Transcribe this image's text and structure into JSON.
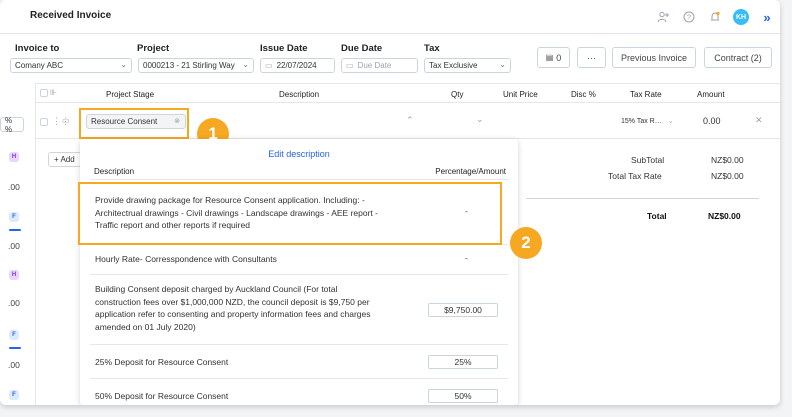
{
  "header": {
    "title": "Received Invoice",
    "icons": [
      "add-user-icon",
      "help-icon",
      "bell-icon"
    ],
    "avatar": "KH"
  },
  "filters": {
    "invoice_to": {
      "label": "Invoice to",
      "value": "Comany ABC"
    },
    "project": {
      "label": "Project",
      "value": "0000213 - 21 Stirling Way"
    },
    "issue_date": {
      "label": "Issue Date",
      "value": "22/07/2024"
    },
    "due_date": {
      "label": "Due Date",
      "placeholder": "Due Date"
    },
    "tax": {
      "label": "Tax",
      "value": "Tax Exclusive"
    }
  },
  "toolbar": {
    "attach_count": "0",
    "more": "···",
    "previous_invoice": "Previous Invoice",
    "contract": "Contract (2)"
  },
  "table": {
    "columns": [
      "Project Stage",
      "Description",
      "Qty",
      "Unit Price",
      "Disc %",
      "Tax Rate",
      "Amount"
    ],
    "row": {
      "stage": "Resource Consent",
      "tax_rate": "15% Tax R…",
      "amount": "0.00"
    }
  },
  "left_fragments": {
    "pct": "% %",
    "values": [
      ".00",
      ".00",
      ".00",
      ".00",
      ".00"
    ],
    "pills": [
      "H",
      "F",
      "H",
      "F",
      "F"
    ]
  },
  "add_button": "+ Add",
  "totals": {
    "subtotal_label": "SubTotal",
    "subtotal_value": "NZ$0.00",
    "tax_label": "Total Tax Rate",
    "tax_value": "NZ$0.00",
    "total_label": "Total",
    "total_value": "NZ$0.00"
  },
  "dropdown": {
    "edit_link": "Edit description",
    "col_description": "Description",
    "col_pct": "Percentage/Amount",
    "options": [
      {
        "line1": "Provide drawing package for Resource Consent application. Including: -",
        "line2": "Architectrual drawings - Civil drawings - Landscape drawings - AEE report -",
        "line3": "Traffic report and other reports if required",
        "value": "-"
      },
      {
        "line1": "Hourly Rate- Corresspondence with Consultants",
        "value": "-"
      },
      {
        "line1": "Building Consent deposit charged by Auckland Council (For total",
        "line2": "construction fees over $1,000,000 NZD, the council deposit is $9,750 per",
        "line3": "application refer to consenting and property information fees and charges",
        "line4": "amended on 01 July 2020)",
        "value": "$9,750.00"
      },
      {
        "line1": "25% Deposit for Resource Consent",
        "value": "25%"
      },
      {
        "line1": "50% Deposit for Resource Consent",
        "value": "50%"
      }
    ]
  },
  "callouts": [
    "1",
    "2"
  ],
  "colors": {
    "accent": "#f7a823",
    "link": "#2563eb"
  }
}
